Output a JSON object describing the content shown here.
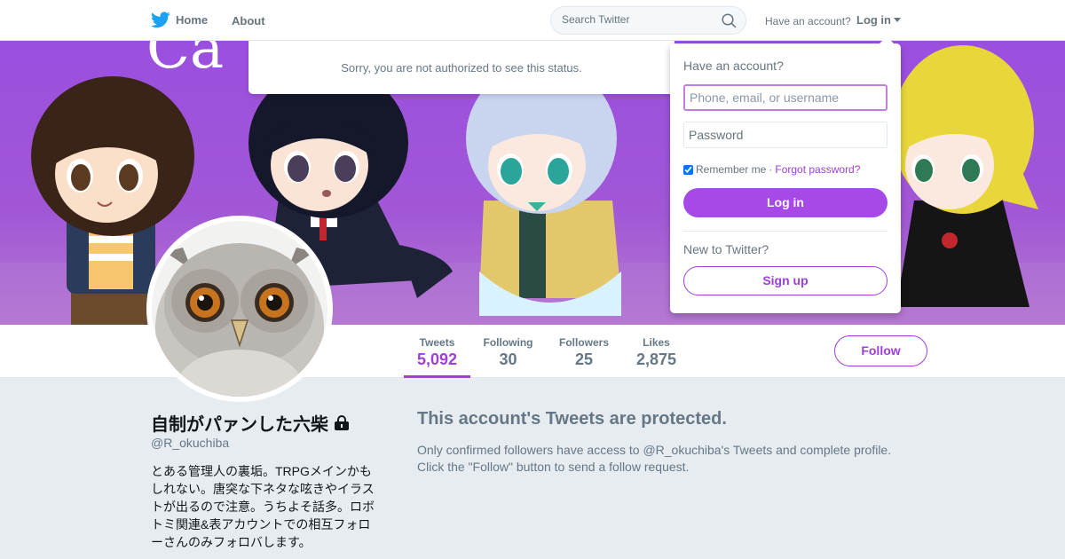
{
  "nav": {
    "home_label": "Home",
    "about_label": "About",
    "search_placeholder": "Search Twitter",
    "have_account": "Have an account?",
    "login_toggle": "Log in"
  },
  "banner": {
    "partial_text": "Ca"
  },
  "toast": {
    "message": "Sorry, you are not authorized to see this status."
  },
  "login_dropdown": {
    "title": "Have an account?",
    "username_placeholder": "Phone, email, or username",
    "password_placeholder": "Password",
    "remember_me": "Remember me",
    "separator": "·",
    "forgot_password": "Forgot password?",
    "login_button": "Log in",
    "new_to_twitter": "New to Twitter?",
    "signup_button": "Sign up"
  },
  "profile_nav": {
    "stats": [
      {
        "label": "Tweets",
        "value": "5,092"
      },
      {
        "label": "Following",
        "value": "30"
      },
      {
        "label": "Followers",
        "value": "25"
      },
      {
        "label": "Likes",
        "value": "2,875"
      }
    ],
    "follow_button": "Follow"
  },
  "profile": {
    "name": "自制がパァンした六柴",
    "handle": "@R_okuchiba",
    "bio": "とある管理人の裏垢。TRPGメインかもしれない。唐突な下ネタな呟きやイラストが出るので注意。うちよそ話多。ロボトミ関連&表アカウントでの相互フォローさんのみフォロバします。"
  },
  "protected": {
    "title": "This account's Tweets are protected.",
    "line1": "Only confirmed followers have access to @R_okuchiba's Tweets and complete profile.",
    "line2": "Click the \"Follow\" button to send a follow request."
  },
  "colors": {
    "accent": "#9d3fd8",
    "login_button": "#a649e6",
    "twitter_blue": "#1da1f2"
  },
  "icons": [
    "twitter-bird-icon",
    "search-icon",
    "caret-down-icon",
    "lock-icon"
  ]
}
